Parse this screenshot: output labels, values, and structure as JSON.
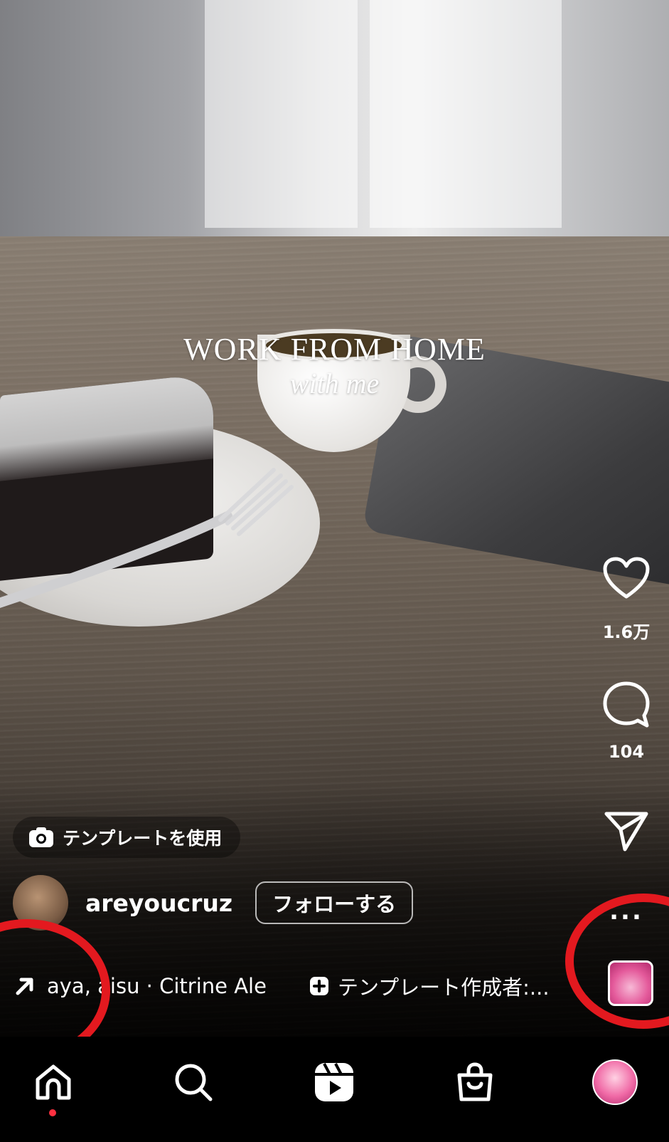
{
  "overlay": {
    "title": "WORK FROM HOME",
    "subtitle": "with me"
  },
  "actions": {
    "likes": "1.6万",
    "comments": "104",
    "more": "..."
  },
  "template_chip": {
    "label": "テンプレートを使用"
  },
  "user": {
    "username": "areyoucruz",
    "follow_label": "フォローする"
  },
  "audio": {
    "text": "aya, aisu · Citrine  Ale",
    "template_creator": "テンプレート作成者:..."
  },
  "nav": {
    "items": [
      "home-icon",
      "search-icon",
      "reels-icon",
      "shop-icon",
      "profile-avatar"
    ]
  },
  "annotations": {
    "color": "#e3191f"
  }
}
